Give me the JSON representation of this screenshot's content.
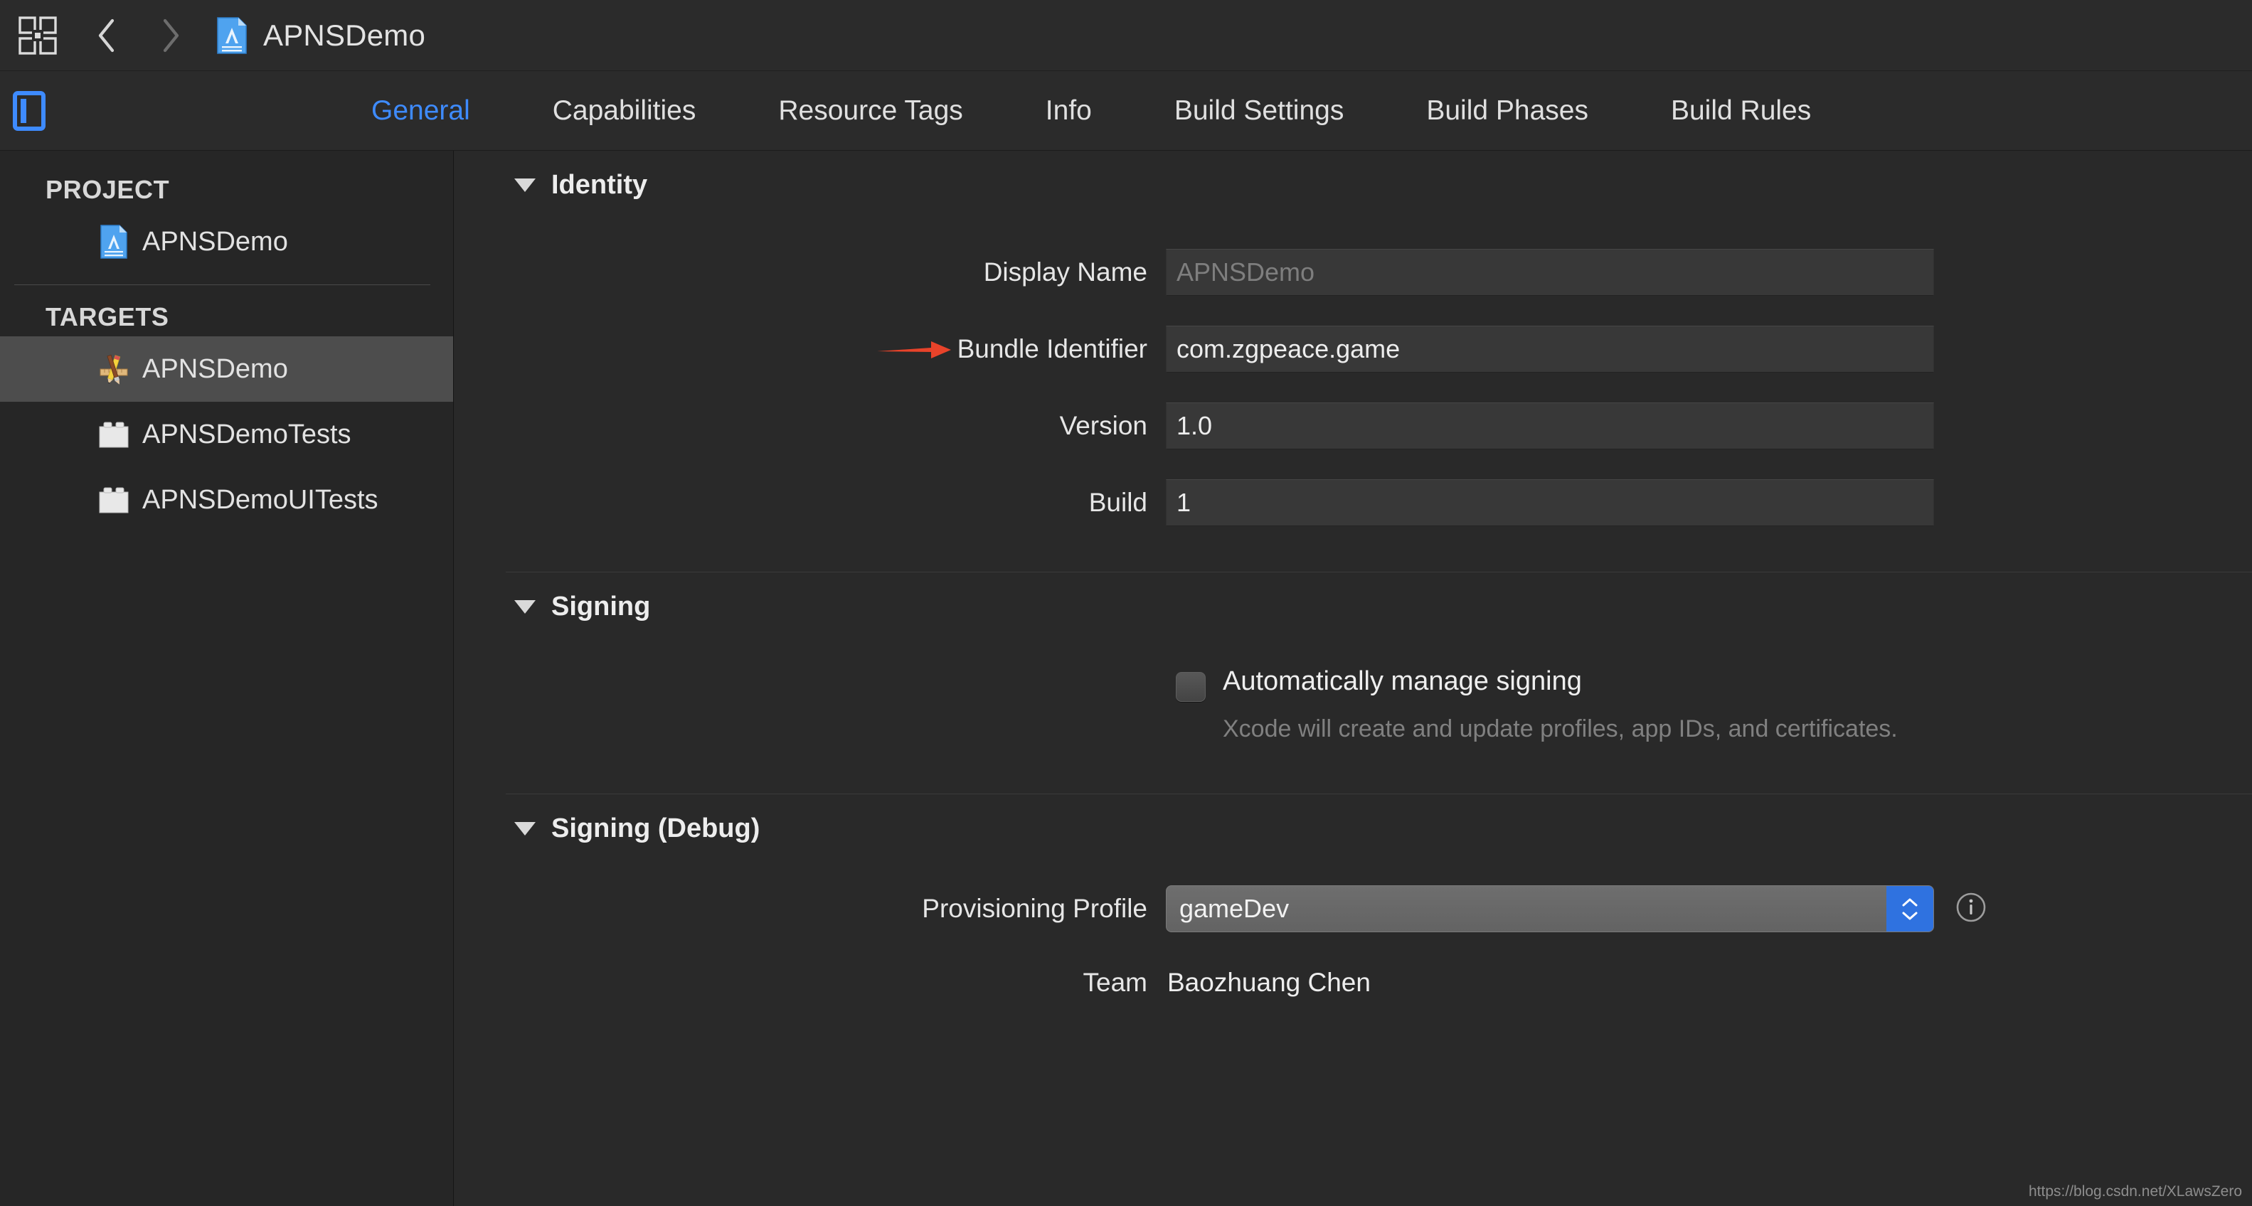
{
  "titlebar": {
    "project_name": "APNSDemo",
    "grid_icon": "grid-icon",
    "back_icon": "back-chevron-icon",
    "forward_icon": "forward-chevron-icon",
    "doc_icon": "xcode-project-document-icon"
  },
  "tabbar": {
    "sidebar_toggle_icon": "sidebar-toggle-icon",
    "active_tab": "General",
    "tabs": [
      {
        "label": "General",
        "active": true
      },
      {
        "label": "Capabilities",
        "active": false
      },
      {
        "label": "Resource Tags",
        "active": false
      },
      {
        "label": "Info",
        "active": false
      },
      {
        "label": "Build Settings",
        "active": false
      },
      {
        "label": "Build Phases",
        "active": false
      },
      {
        "label": "Build Rules",
        "active": false
      }
    ]
  },
  "sidebar": {
    "project_header": "PROJECT",
    "targets_header": "TARGETS",
    "project_items": [
      {
        "label": "APNSDemo",
        "icon": "xcode-project-document-icon"
      }
    ],
    "target_items": [
      {
        "label": "APNSDemo",
        "icon": "app-target-icon",
        "selected": true
      },
      {
        "label": "APNSDemoTests",
        "icon": "test-bundle-icon",
        "selected": false
      },
      {
        "label": "APNSDemoUITests",
        "icon": "test-bundle-icon",
        "selected": false
      }
    ]
  },
  "main": {
    "identity": {
      "title": "Identity",
      "fields": [
        {
          "label": "Display Name",
          "value": "APNSDemo",
          "is_placeholder": true
        },
        {
          "label": "Bundle Identifier",
          "value": "com.zgpeace.game",
          "is_placeholder": false,
          "annotated": true
        },
        {
          "label": "Version",
          "value": "1.0",
          "is_placeholder": false
        },
        {
          "label": "Build",
          "value": "1",
          "is_placeholder": false
        }
      ]
    },
    "signing": {
      "title": "Signing",
      "checkbox_label": "Automatically manage signing",
      "checkbox_checked": false,
      "hint": "Xcode will create and update profiles, app IDs, and certificates."
    },
    "signing_debug": {
      "title": "Signing (Debug)",
      "provisioning_profile_label": "Provisioning Profile",
      "provisioning_profile_value": "gameDev",
      "info_icon": "info-circle-icon",
      "team_label": "Team",
      "team_value": "Baozhuang Chen"
    }
  },
  "annotation": {
    "arrow_color": "#e8432a",
    "arrow_icon": "red-arrow-annotation"
  },
  "watermark": "https://blog.csdn.net/XLawsZero",
  "colors": {
    "accent_blue": "#3e8bff",
    "window_bg": "#292929",
    "sidebar_bg": "#262626",
    "selection": "#4d4d4d",
    "field_bg": "#383838"
  }
}
